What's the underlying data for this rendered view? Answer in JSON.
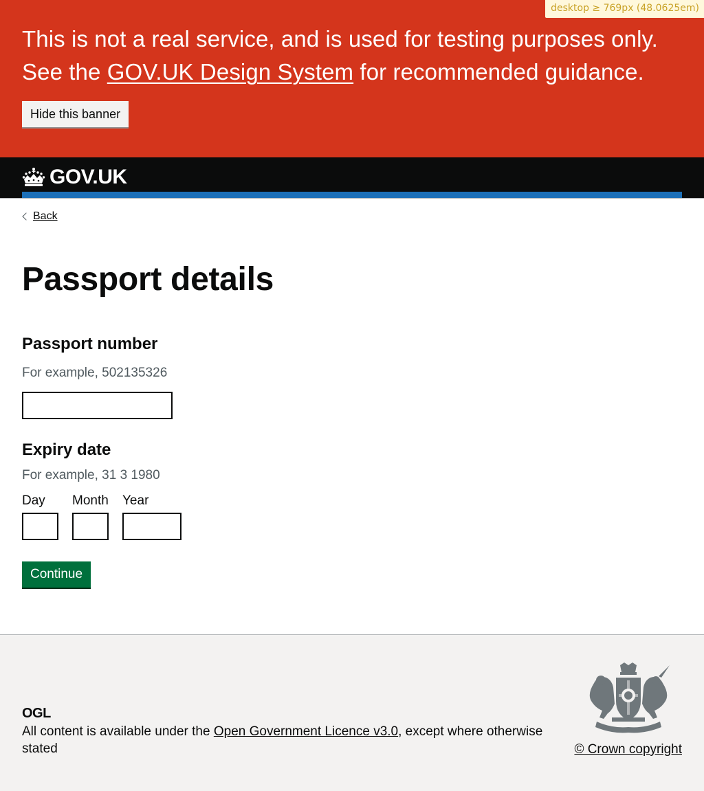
{
  "breakpoint_tag": "desktop ≥ 769px (48.0625em)",
  "banner": {
    "text_before": "This is not a real service, and is used for testing purposes only. See the ",
    "link_text": "GOV.UK Design System",
    "text_after": " for recommended guidance.",
    "hide_button": "Hide this banner",
    "color": "#d4351c"
  },
  "header": {
    "logo_text": "GOV.UK",
    "logo_icon": "crown-icon"
  },
  "nav": {
    "back_label": "Back"
  },
  "page": {
    "title": "Passport details"
  },
  "form": {
    "passport": {
      "label": "Passport number",
      "hint": "For example, 502135326",
      "value": ""
    },
    "expiry": {
      "label": "Expiry date",
      "hint": "For example, 31 3 1980",
      "day_label": "Day",
      "month_label": "Month",
      "year_label": "Year",
      "day_value": "",
      "month_value": "",
      "year_value": ""
    },
    "continue_label": "Continue",
    "continue_color": "#00703c"
  },
  "footer": {
    "ogl_logo": "OGL",
    "licence_before": "All content is available under the ",
    "licence_link": "Open Government Licence v3.0",
    "licence_after": ", except where otherwise stated",
    "copyright": "© Crown copyright",
    "crest_icon": "royal-coat-of-arms-icon"
  }
}
